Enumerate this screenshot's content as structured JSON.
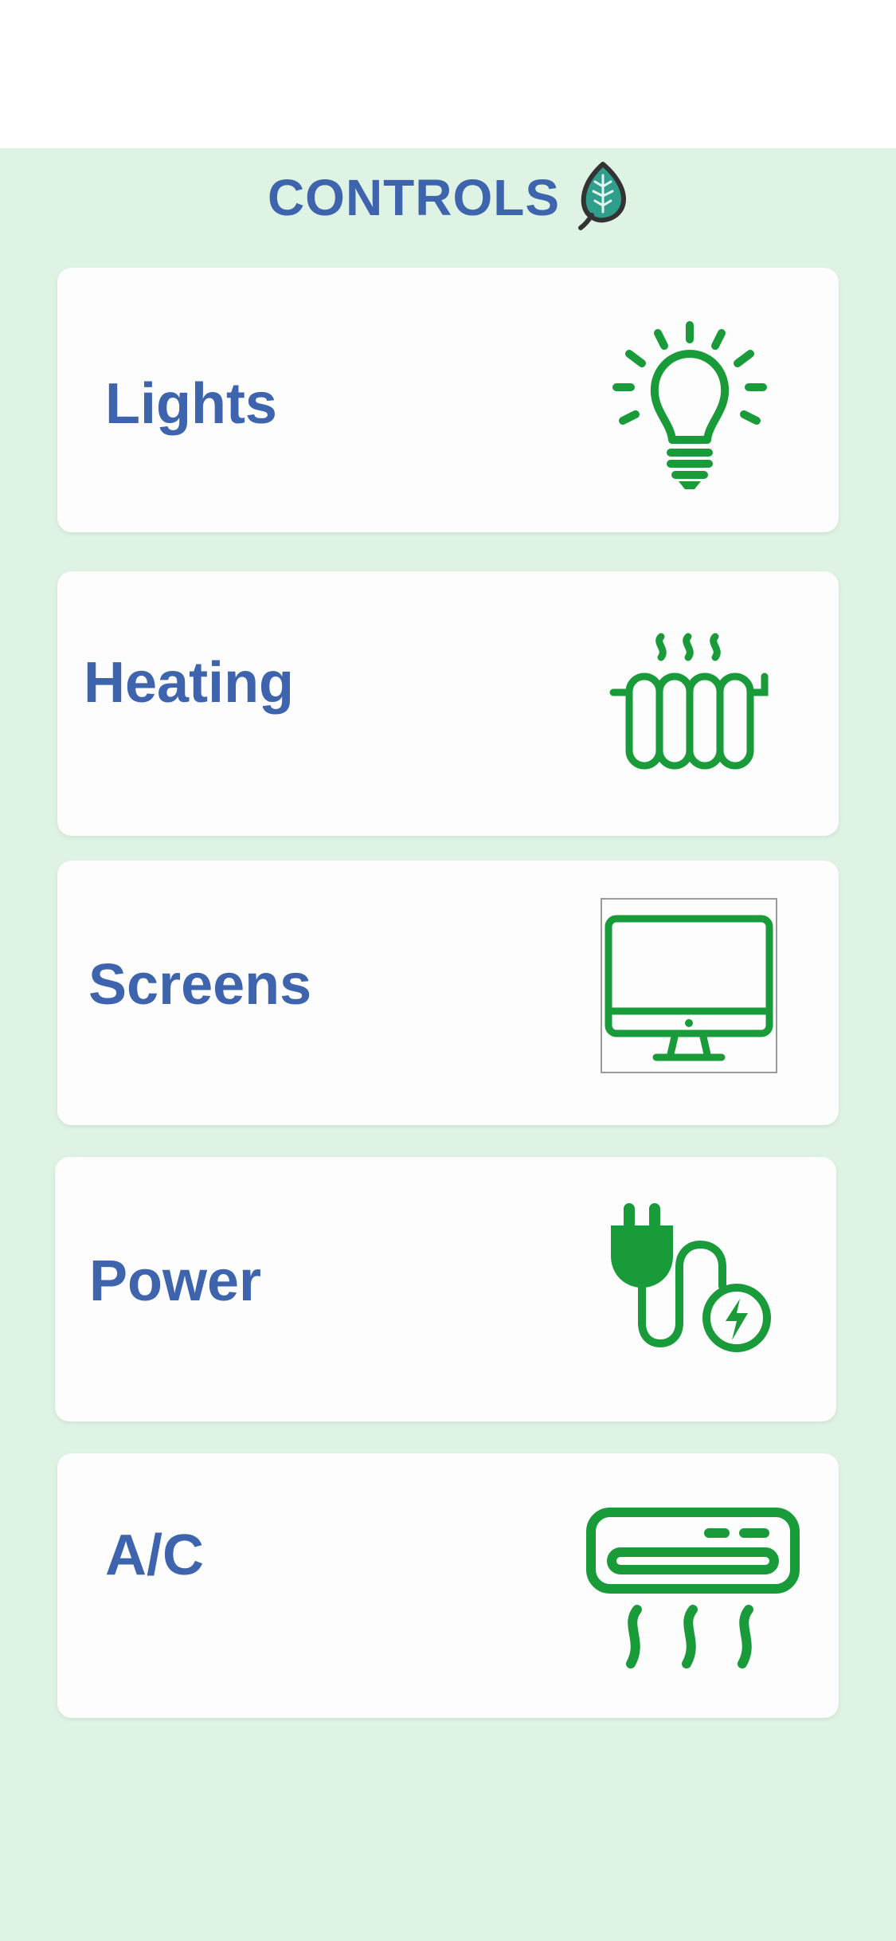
{
  "header": {
    "title": "CONTROLS",
    "icon": "leaf-icon"
  },
  "controls": [
    {
      "label": "Lights",
      "icon": "lightbulb-icon"
    },
    {
      "label": "Heating",
      "icon": "radiator-icon"
    },
    {
      "label": "Screens",
      "icon": "monitor-icon"
    },
    {
      "label": "Power",
      "icon": "power-plug-icon"
    },
    {
      "label": "A/C",
      "icon": "air-conditioner-icon"
    }
  ],
  "colors": {
    "background": "#dff3e4",
    "card": "#fdfdfd",
    "text": "#3e64ad",
    "icon": "#1a9b3a"
  }
}
